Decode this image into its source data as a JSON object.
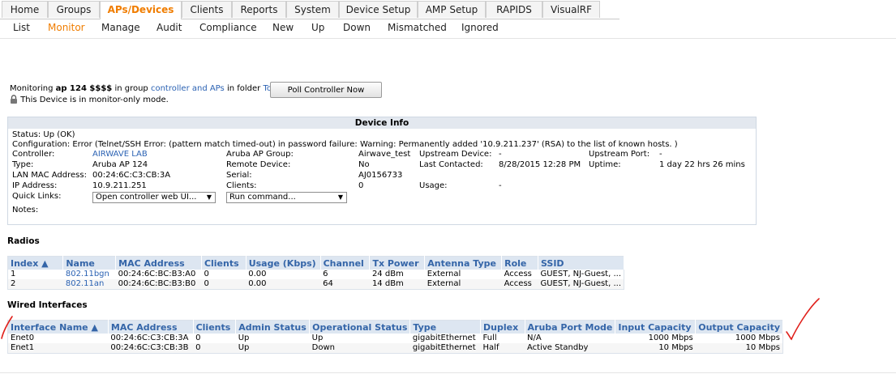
{
  "tabs": [
    "Home",
    "Groups",
    "APs/Devices",
    "Clients",
    "Reports",
    "System",
    "Device Setup",
    "AMP Setup",
    "RAPIDS",
    "VisualRF"
  ],
  "active_tab": "APs/Devices",
  "subnav": [
    "List",
    "Monitor",
    "Manage",
    "Audit",
    "Compliance",
    "New",
    "Up",
    "Down",
    "Mismatched",
    "Ignored"
  ],
  "active_subnav": "Monitor",
  "monitoring": {
    "prefix": "Monitoring",
    "device": "ap 124 $$$$",
    "in_group": "in group",
    "group": "controller and APs",
    "in_folder": "in folder",
    "folder": "Top",
    "poll_button": "Poll Controller Now",
    "mode_note": "This Device is in monitor-only mode."
  },
  "device_info": {
    "title": "Device Info",
    "status": "Status: Up (OK)",
    "configuration": "Configuration: Error (Telnet/SSH Error: (pattern match timed-out) in password failure: Warning: Permanently added '10.9.211.237' (RSA) to the list of known hosts. )",
    "labels": {
      "controller": "Controller:",
      "type": "Type:",
      "lan_mac": "LAN MAC Address:",
      "ip": "IP Address:",
      "quick_links": "Quick Links:",
      "notes": "Notes:",
      "ap_group": "Aruba AP Group:",
      "remote": "Remote Device:",
      "serial": "Serial:",
      "clients": "Clients:",
      "upstream_device": "Upstream Device:",
      "last_contacted": "Last Contacted:",
      "usage": "Usage:",
      "upstream_port": "Upstream Port:",
      "uptime": "Uptime:"
    },
    "values": {
      "controller": "AIRWAVE LAB",
      "type": "Aruba AP 124",
      "lan_mac": "00:24:6C:C3:CB:3A",
      "ip": "10.9.211.251",
      "ap_group": "Airwave_test",
      "remote": "No",
      "serial": "AJ0156733",
      "clients": "0",
      "upstream_device": "-",
      "last_contacted": "8/28/2015 12:28 PM",
      "usage": "-",
      "upstream_port": "-",
      "uptime": "1 day 22 hrs 26 mins"
    },
    "quick_links_select": "Open controller web UI...",
    "run_command_select": "Run command..."
  },
  "radios": {
    "title": "Radios",
    "columns": [
      "Index ▲",
      "Name",
      "MAC Address",
      "Clients",
      "Usage (Kbps)",
      "Channel",
      "Tx Power",
      "Antenna Type",
      "Role",
      "SSID"
    ],
    "rows": [
      [
        "1",
        "802.11bgn",
        "00:24:6C:BC:B3:A0",
        "0",
        "0.00",
        "6",
        "24 dBm",
        "External",
        "Access",
        "GUEST, NJ-Guest, ..."
      ],
      [
        "2",
        "802.11an",
        "00:24:6C:BC:B3:B0",
        "0",
        "0.00",
        "64",
        "14 dBm",
        "External",
        "Access",
        "GUEST, NJ-Guest, ..."
      ]
    ]
  },
  "wired": {
    "title": "Wired Interfaces",
    "columns": [
      "Interface Name ▲",
      "MAC Address",
      "Clients",
      "Admin Status",
      "Operational Status",
      "Type",
      "Duplex",
      "Aruba Port Mode",
      "Input Capacity",
      "Output Capacity"
    ],
    "rows": [
      [
        "Enet0",
        "00:24:6C:C3:CB:3A",
        "0",
        "Up",
        "Up",
        "gigabitEthernet",
        "Full",
        "N/A",
        "1000 Mbps",
        "1000 Mbps"
      ],
      [
        "Enet1",
        "00:24:6C:C3:CB:3B",
        "0",
        "Up",
        "Down",
        "gigabitEthernet",
        "Half",
        "Active Standby",
        "10 Mbps",
        "10 Mbps"
      ]
    ]
  },
  "colors": {
    "accent": "#f07d00",
    "link": "#2b62b3",
    "annotation": "#e0201b"
  }
}
